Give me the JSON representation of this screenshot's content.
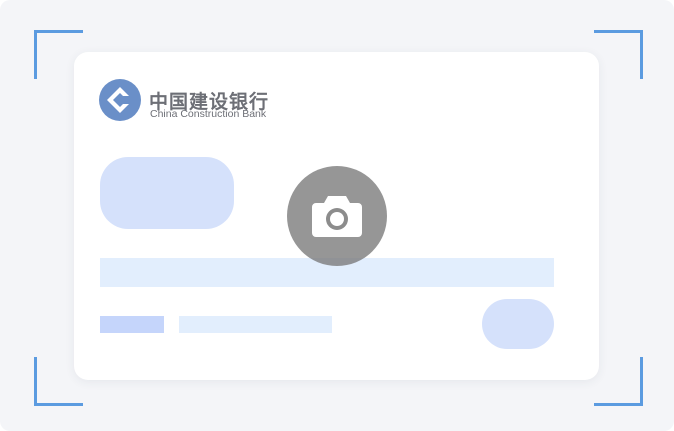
{
  "bank": {
    "name_cn": "中国建设银行",
    "name_en": "China Construction Bank",
    "logo_icon": "ccb-logo-icon"
  },
  "scanner": {
    "camera_icon": "camera-icon"
  },
  "colors": {
    "frame_corner": "#5b9be0",
    "logo_blue": "#6a8fc8",
    "placeholder_dark": "#c5d5fb",
    "placeholder_light": "#e2eefd",
    "camera_overlay": "#8c8c8c"
  }
}
